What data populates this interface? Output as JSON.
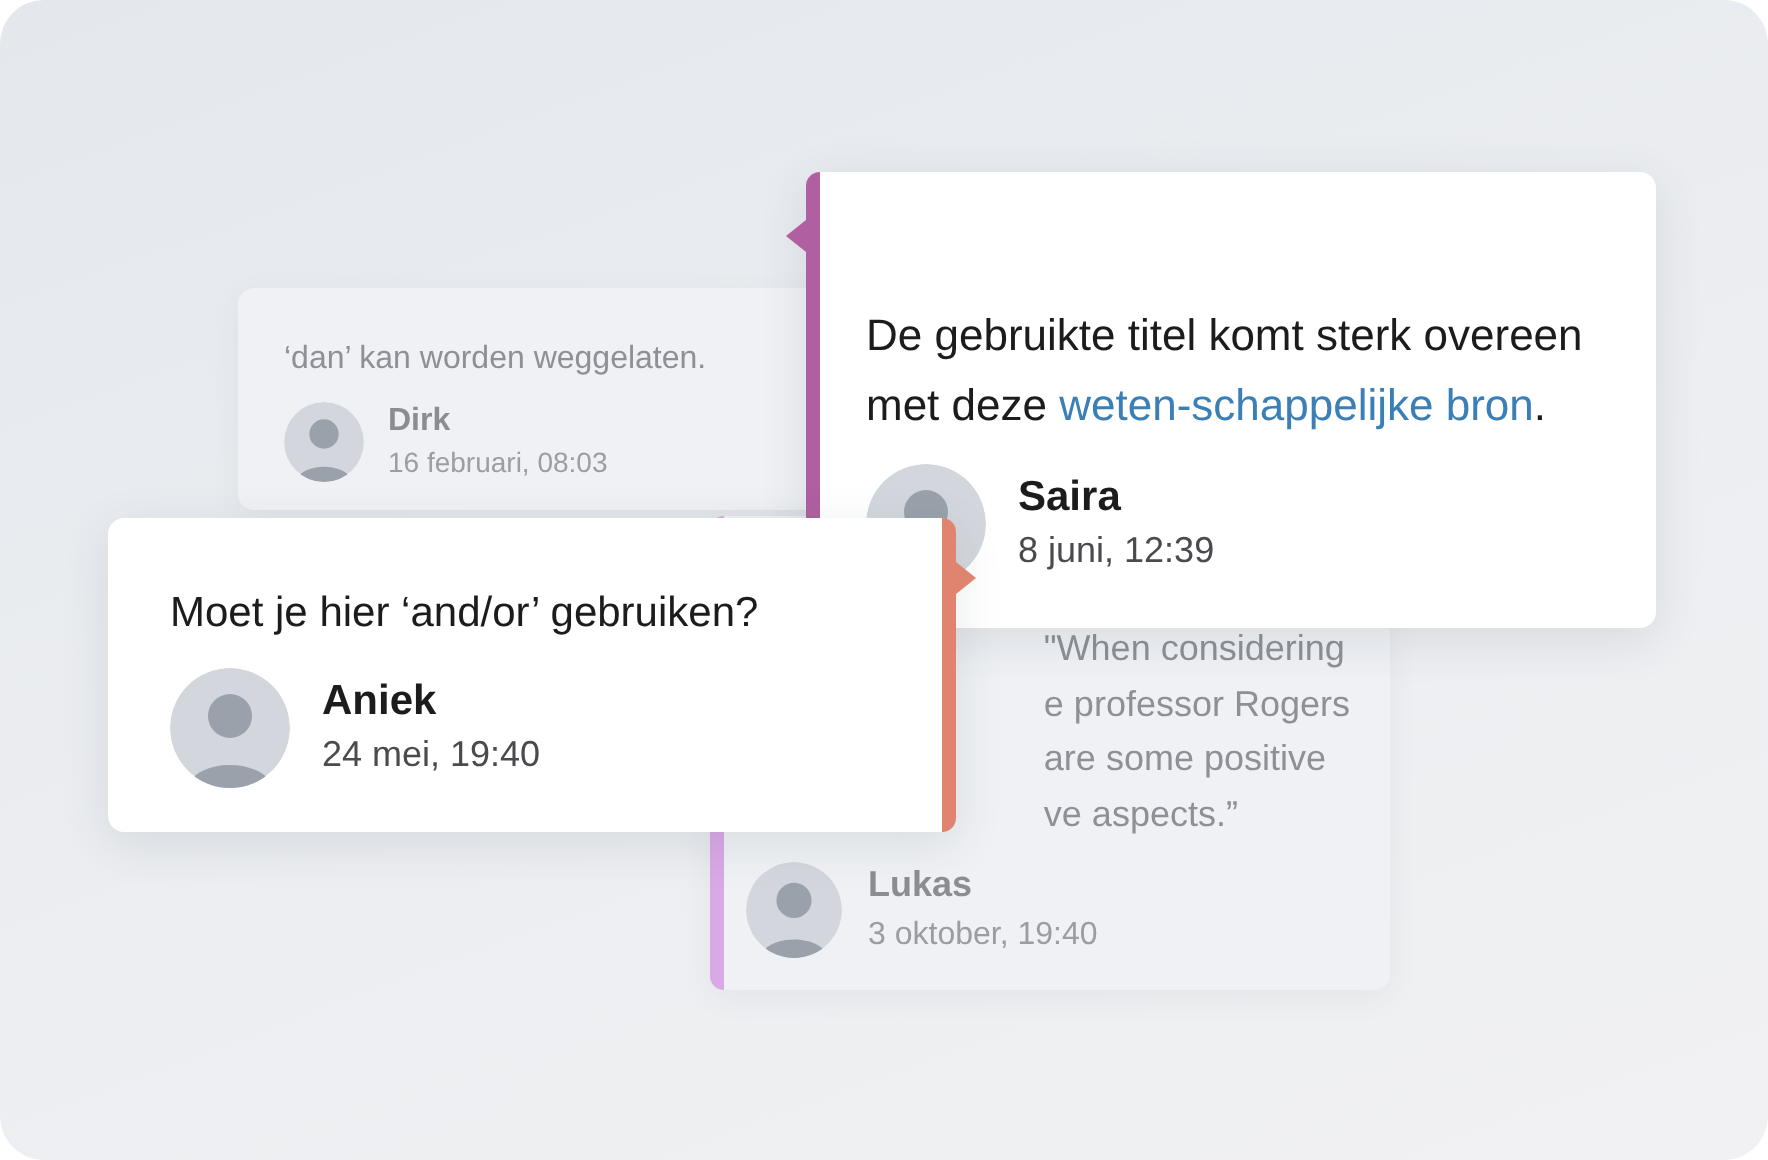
{
  "comments": [
    {
      "kind": "active",
      "color": "#b05fa0",
      "text": [
        {
          "kind": "plain",
          "text": "De gebruikte titel komt sterk overeen met deze "
        },
        {
          "kind": "link",
          "text": "weten-"
        },
        {
          "kind": "link",
          "text": "schappelijke bron"
        },
        {
          "kind": "plain",
          "text": "."
        }
      ],
      "author": "Saira",
      "date": "8 juni, 12:39"
    },
    {
      "kind": "dimmed",
      "text": [
        {
          "kind": "plain",
          "text": "‘dan’ kan worden weggelaten."
        }
      ],
      "author": "Dirk",
      "date": "16 februari, 08:03"
    },
    {
      "kind": "active",
      "color": "#e0836f",
      "text": [
        {
          "kind": "plain",
          "text": "Moet je hier ‘and/or’ gebruiken?"
        }
      ],
      "author": "Aniek",
      "date": "24 mei, 19:40"
    },
    {
      "kind": "dimmed",
      "color": "#d9a8e6",
      "lines": [
        "\"When considering",
        "e professor Rogers",
        "are some positive",
        "ve aspects.”"
      ],
      "author": "Lukas",
      "date": "3 oktober, 19:40"
    }
  ]
}
